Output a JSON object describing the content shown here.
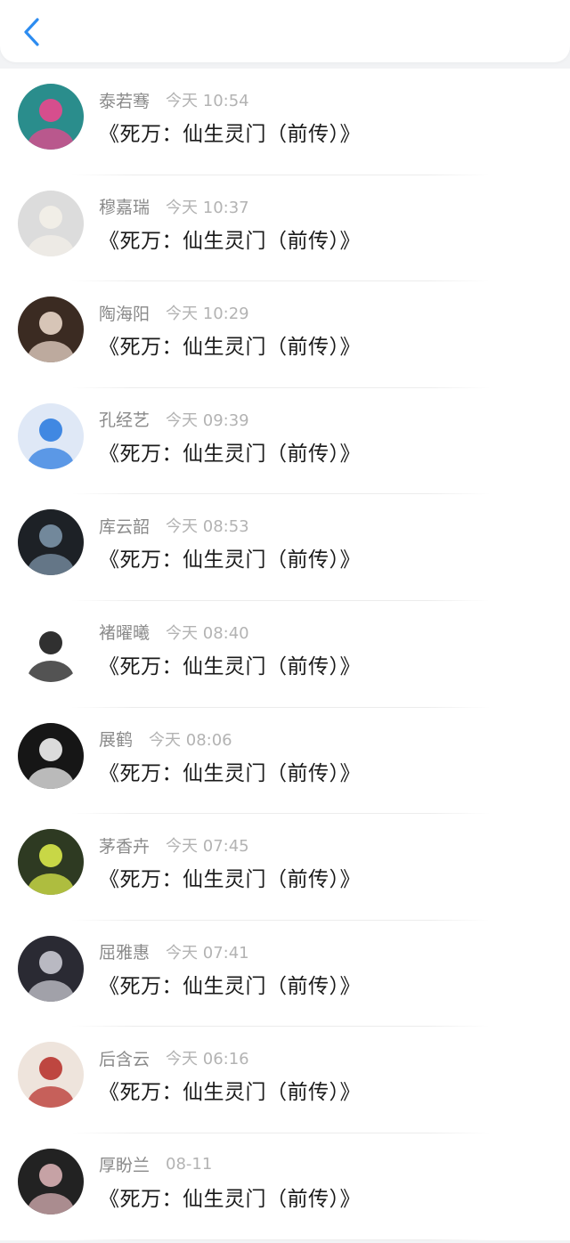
{
  "header": {
    "back_icon": "chevron-left-icon",
    "accent_color": "#2d8cf0"
  },
  "items": [
    {
      "name": "泰若骞",
      "time": "今天 10:54",
      "title": "《死万：仙生灵门（前传）》",
      "avatar_bg": "#2a8d8c",
      "avatar_fg": "#e9478d"
    },
    {
      "name": "穆嘉瑞",
      "time": "今天 10:37",
      "title": "《死万：仙生灵门（前传）》",
      "avatar_bg": "#dcdcdc",
      "avatar_fg": "#f3efe8"
    },
    {
      "name": "陶海阳",
      "time": "今天 10:29",
      "title": "《死万：仙生灵门（前传）》",
      "avatar_bg": "#3b2b22",
      "avatar_fg": "#e9d6c8"
    },
    {
      "name": "孔经艺",
      "time": "今天 09:39",
      "title": "《死万：仙生灵门（前传）》",
      "avatar_bg": "#dfe8f6",
      "avatar_fg": "#2f7de0"
    },
    {
      "name": "库云韶",
      "time": "今天 08:53",
      "title": "《死万：仙生灵门（前传）》",
      "avatar_bg": "#1d2126",
      "avatar_fg": "#7c93a8"
    },
    {
      "name": "褚曜曦",
      "time": "今天 08:40",
      "title": "《死万：仙生灵门（前传）》",
      "avatar_bg": "#ffffff",
      "avatar_fg": "#1a1a1a"
    },
    {
      "name": "展鹤",
      "time": "今天 08:06",
      "title": "《死万：仙生灵门（前传）》",
      "avatar_bg": "#161616",
      "avatar_fg": "#f1f1f1"
    },
    {
      "name": "茅香卉",
      "time": "今天 07:45",
      "title": "《死万：仙生灵门（前传）》",
      "avatar_bg": "#2e3a22",
      "avatar_fg": "#d9e94a"
    },
    {
      "name": "屈雅惠",
      "time": "今天 07:41",
      "title": "《死万：仙生灵门（前传）》",
      "avatar_bg": "#2a2a33",
      "avatar_fg": "#c9c9d2"
    },
    {
      "name": "后含云",
      "time": "今天 06:16",
      "title": "《死万：仙生灵门（前传）》",
      "avatar_bg": "#eee4dc",
      "avatar_fg": "#b8342f"
    },
    {
      "name": "厚盼兰",
      "time": "08-11",
      "title": "《死万：仙生灵门（前传）》",
      "avatar_bg": "#222222",
      "avatar_fg": "#d8b0b4"
    }
  ]
}
